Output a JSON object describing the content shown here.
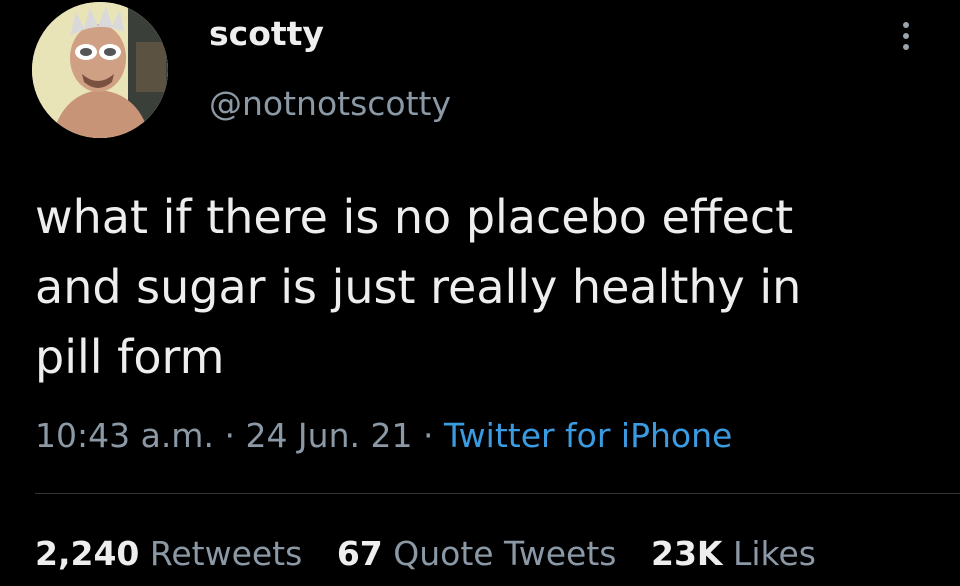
{
  "user": {
    "display_name": "scotty",
    "handle": "@notnotscotty",
    "avatar_icon": "profile-photo"
  },
  "menu": {
    "icon": "more-vertical-icon"
  },
  "tweet": {
    "lines": [
      "what if there is no placebo effect",
      "and sugar is just really healthy in",
      "pill form"
    ]
  },
  "meta": {
    "time": "10:43 a.m.",
    "date": "24 Jun. 21",
    "separator": "·",
    "source": "Twitter for iPhone"
  },
  "stats": {
    "retweets_count": "2,240",
    "retweets_label": "Retweets",
    "quotes_count": "67",
    "quotes_label": "Quote Tweets",
    "likes_count": "23K",
    "likes_label": "Likes"
  },
  "colors": {
    "background": "#000000",
    "text": "#eeeeee",
    "secondary": "#8b98a5",
    "link": "#3b9be0"
  }
}
